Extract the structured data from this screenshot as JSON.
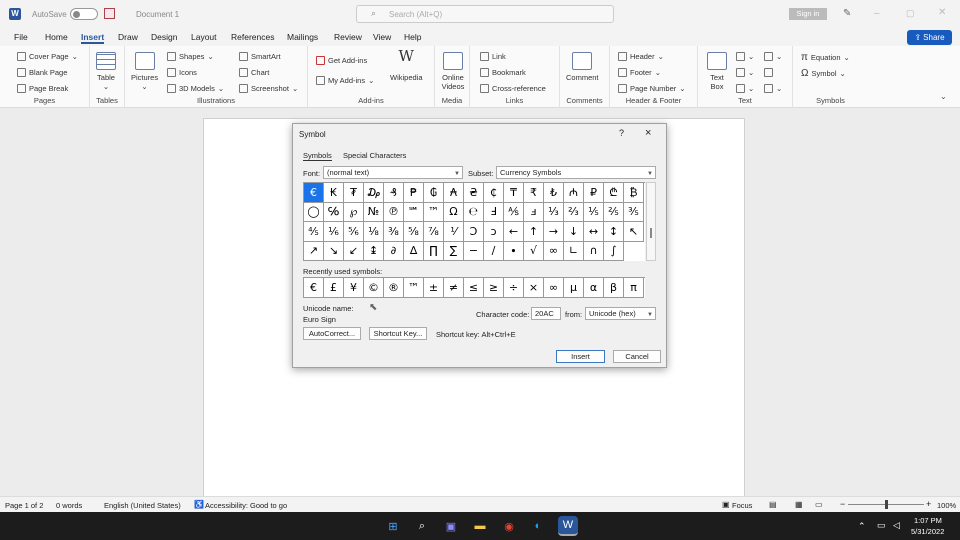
{
  "title": {
    "autosave": "AutoSave",
    "autosave_state": "Off",
    "doc": "Document 1",
    "search_placeholder": "Search (Alt+Q)",
    "signin": "Sign in"
  },
  "tabs": [
    "File",
    "Home",
    "Insert",
    "Draw",
    "Design",
    "Layout",
    "References",
    "Mailings",
    "Review",
    "View",
    "Help"
  ],
  "active_tab": "Insert",
  "share": "Share",
  "ribbon": {
    "pages": {
      "items": [
        "Cover Page",
        "Blank Page",
        "Page Break"
      ],
      "label": "Pages"
    },
    "tables": {
      "item": "Table",
      "label": "Tables"
    },
    "illustrations": {
      "pictures": "Pictures",
      "shapes": "Shapes",
      "icons": "Icons",
      "models": "3D Models",
      "smartart": "SmartArt",
      "chart": "Chart",
      "screenshot": "Screenshot",
      "label": "Illustrations"
    },
    "addins": {
      "get": "Get Add-ins",
      "my": "My Add-ins",
      "wiki": "Wikipedia",
      "label": "Add-ins"
    },
    "media": {
      "online_videos": "Online Videos",
      "label": "Media"
    },
    "links": {
      "link": "Link",
      "bookmark": "Bookmark",
      "crossref": "Cross-reference",
      "label": "Links"
    },
    "comments": {
      "comment": "Comment",
      "label": "Comments"
    },
    "header_footer": {
      "header": "Header",
      "footer": "Footer",
      "page_number": "Page Number",
      "label": "Header & Footer"
    },
    "text": {
      "textbox": "Text Box",
      "label": "Text"
    },
    "symbols": {
      "equation": "Equation",
      "symbol": "Symbol",
      "label": "Symbols"
    }
  },
  "dialog": {
    "title": "Symbol",
    "help": "?",
    "close": "×",
    "tabs": [
      "Symbols",
      "Special Characters"
    ],
    "font_label": "Font:",
    "font_value": "(normal text)",
    "subset_label": "Subset:",
    "subset_value": "Currency Symbols",
    "symbols": [
      "€",
      "₭",
      "₮",
      "₯",
      "₰",
      "₱",
      "₲",
      "₳",
      "₴",
      "₵",
      "₸",
      "₹",
      "₺",
      "₼",
      "₽",
      "₾",
      "₿",
      "◯",
      "℅",
      "℘",
      "№",
      "℗",
      "℠",
      "™",
      "Ω",
      "℮",
      "Ⅎ",
      "⅍",
      "ⅎ",
      "⅓",
      "⅔",
      "⅕",
      "⅖",
      "⅗",
      "⅘",
      "⅙",
      "⅚",
      "⅛",
      "⅜",
      "⅝",
      "⅞",
      "⅟",
      "Ↄ",
      "ↄ",
      "←",
      "↑",
      "→",
      "↓",
      "↔",
      "↕",
      "↖",
      "↗",
      "↘",
      "↙",
      "↨",
      "∂",
      "∆",
      "∏",
      "∑",
      "−",
      "∕",
      "∙",
      "√",
      "∞",
      "∟",
      "∩",
      "∫"
    ],
    "recent_label": "Recently used symbols:",
    "recent": [
      "€",
      "£",
      "¥",
      "©",
      "®",
      "™",
      "±",
      "≠",
      "≤",
      "≥",
      "÷",
      "×",
      "∞",
      "µ",
      "α",
      "β",
      "π"
    ],
    "unicode_name_label": "Unicode name:",
    "unicode_name": "Euro Sign",
    "char_code_label": "Character code:",
    "char_code": "20AC",
    "from_label": "from:",
    "from_value": "Unicode (hex)",
    "autocorrect": "AutoCorrect...",
    "shortcut_key_btn": "Shortcut Key...",
    "shortcut_text": "Shortcut key: Alt+Ctrl+E",
    "insert": "Insert",
    "cancel": "Cancel"
  },
  "status": {
    "page": "Page 1 of 2",
    "words": "0 words",
    "lang": "English (United States)",
    "access": "Accessibility: Good to go",
    "focus": "Focus",
    "zoom": "100%"
  },
  "taskbar": {
    "time": "1:07 PM",
    "date": "5/31/2022"
  },
  "colors": {
    "accent": "#2b579a",
    "selected": "#1a73e8",
    "share": "#185abd"
  }
}
